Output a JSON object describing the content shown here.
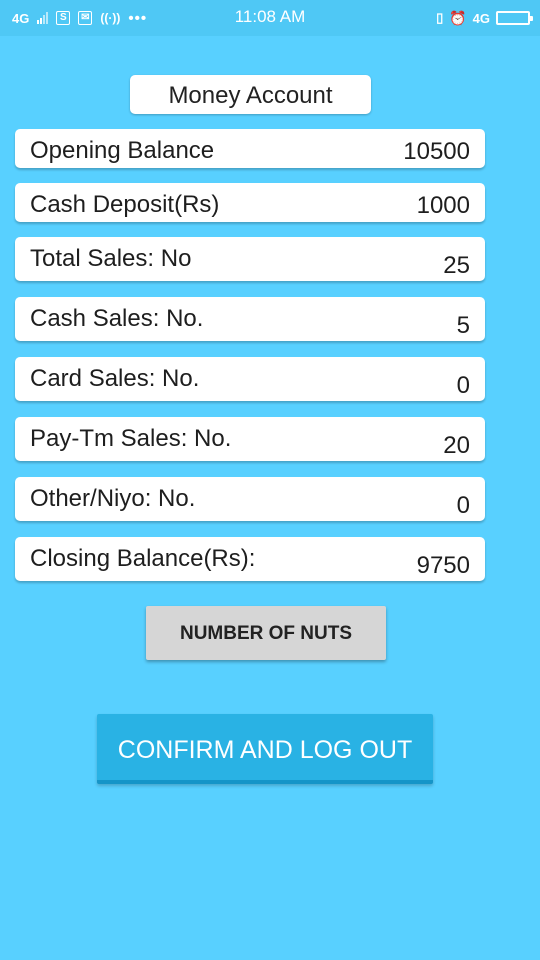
{
  "status_bar": {
    "network_left": "4G",
    "time": "11:08 AM",
    "network_right": "4G",
    "icons": [
      "signal-icon",
      "sim-icon",
      "mail-icon",
      "wifi-signal-icon",
      "more-dots-icon",
      "vibrate-icon",
      "alarm-icon",
      "battery-icon"
    ]
  },
  "title": "Money Account",
  "rows": [
    {
      "label": "Opening Balance",
      "value": "10500"
    },
    {
      "label": "Cash Deposit(Rs)",
      "value": "1000"
    },
    {
      "label": "Total Sales: No",
      "value": "25"
    },
    {
      "label": "Cash Sales: No.",
      "value": "5"
    },
    {
      "label": "Card Sales: No.",
      "value": "0"
    },
    {
      "label": "Pay-Tm Sales: No.",
      "value": "20"
    },
    {
      "label": "Other/Niyo: No.",
      "value": "0"
    },
    {
      "label": "Closing Balance(Rs):",
      "value": "9750"
    }
  ],
  "buttons": {
    "nuts": "NUMBER OF NUTS",
    "confirm": "CONFIRM AND LOG OUT"
  },
  "colors": {
    "background": "#58d0ff",
    "status_bar": "#4fc8f5",
    "confirm_button": "#29b2e4",
    "nuts_button": "#d6d6d6"
  }
}
